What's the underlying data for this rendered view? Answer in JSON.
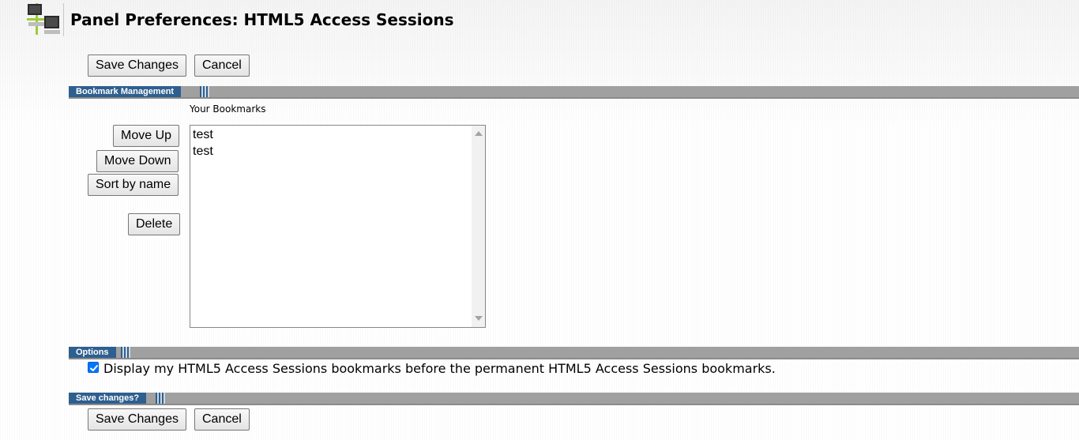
{
  "header": {
    "title": "Panel Preferences: HTML5 Access Sessions",
    "icon": "network-computers-icon"
  },
  "top_actions": {
    "save_label": "Save Changes",
    "cancel_label": "Cancel"
  },
  "bookmark_section": {
    "title": "Bookmark Management",
    "list_label": "Your Bookmarks",
    "move_up_label": "Move Up",
    "move_down_label": "Move Down",
    "sort_label": "Sort by name",
    "delete_label": "Delete",
    "bookmarks": [
      "test",
      "test"
    ]
  },
  "options_section": {
    "title": "Options",
    "display_checkbox": {
      "checked": true,
      "label": "Display my HTML5 Access Sessions bookmarks before the permanent HTML5 Access Sessions bookmarks."
    }
  },
  "save_section": {
    "title": "Save changes?",
    "save_label": "Save Changes",
    "cancel_label": "Cancel"
  },
  "colors": {
    "section_header": "#2e5f8f",
    "section_bar": "#a0a0a0",
    "checkbox_accent": "#0075ff"
  }
}
